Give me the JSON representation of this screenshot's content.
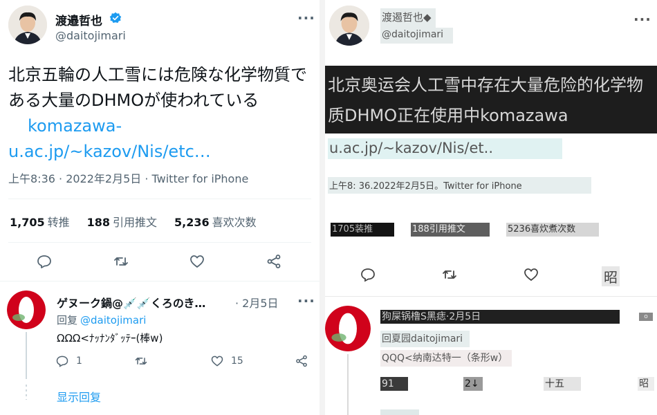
{
  "left": {
    "author": {
      "name": "渡邉哲也",
      "handle": "@daitojimari",
      "verified_color": "#1d9bf0"
    },
    "tweet": {
      "text": "北京五輪の人工雪には危険な化学物質である大量のDHMOが使われている",
      "link": "komazawa-u.ac.jp/~kazov/Nis/etc…",
      "timestamp": "上午8:36 · 2022年2月5日 · Twitter for iPhone"
    },
    "stats": [
      {
        "count": "1,705",
        "label": "转推"
      },
      {
        "count": "188",
        "label": "引用推文"
      },
      {
        "count": "5,236",
        "label": "喜欢次数"
      }
    ],
    "actions": [
      "reply-icon",
      "retweet-icon",
      "like-icon",
      "share-icon"
    ],
    "reply": {
      "name": "ゲヌーク鍋@💉💉くろのき…",
      "date": "· 2月5日",
      "replying_to_prefix": "回复",
      "replying_to_handle": "@daitojimari",
      "text": "ΩΩΩ<ﾅｯﾅﾝﾀﾞｯﾃｰ(棒w)",
      "reply_count": "1",
      "like_count": "15"
    },
    "show_replies": "显示回复",
    "colors": {
      "link": "#1d9bf0",
      "muted": "#536471",
      "avatar_ring": "#d0021b"
    }
  },
  "right": {
    "author": {
      "name": "渡遏哲也◆",
      "handle": "@daitojimari"
    },
    "tweet": {
      "text": "北京奥运会人工雪中存在大量危险的化学物质DHMO正在使用中komazawa",
      "link": "u.ac.jp/~kazov/Nis/et..",
      "timestamp": "上午8:  36.2022年2月5日。Twitter for iPhone"
    },
    "stats": [
      "1705装推",
      "188引用推文",
      "5236喜炊煮次数"
    ],
    "action_label": "昭",
    "reply": {
      "name": "狗屎锅橹S黑痣·2月5日",
      "more": "o",
      "replying_to": "回夏园daitojimari",
      "text": "QQQ<纳南达特一（条形w）",
      "counts": [
        "91",
        "2↓",
        "十五",
        "昭"
      ]
    }
  }
}
